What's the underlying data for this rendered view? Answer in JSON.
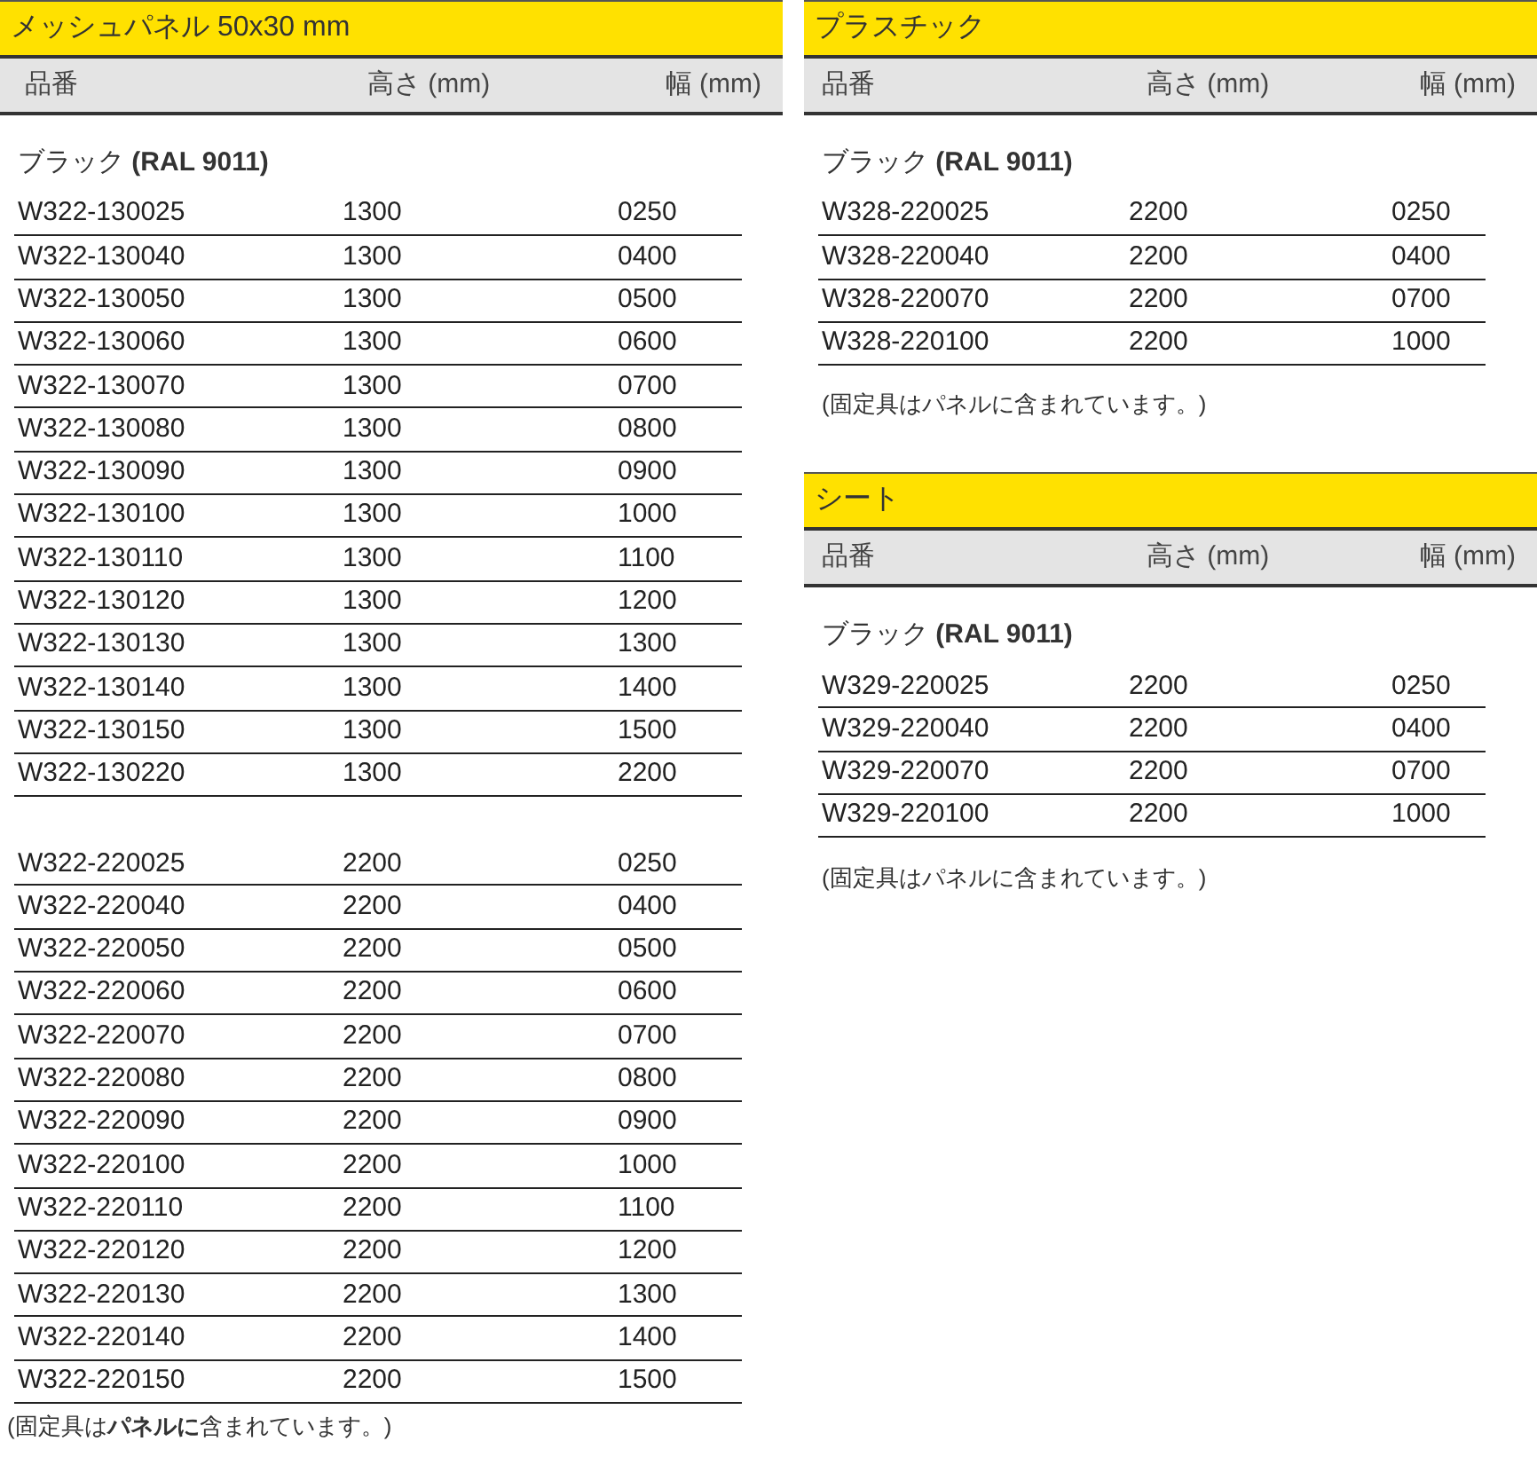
{
  "left": [
    {
      "title": "メッシュパネル 50x30 mm",
      "columns": [
        "品番",
        "高さ (mm)",
        "幅 (mm)"
      ],
      "groups": [
        {
          "label": "ブラック **(RAL 9011)**",
          "rows": [
            [
              "W322-130025",
              "1300",
              "0250"
            ],
            [
              "W322-130040",
              "1300",
              "0400"
            ],
            [
              "W322-130050",
              "1300",
              "0500"
            ],
            [
              "W322-130060",
              "1300",
              "0600"
            ],
            [
              "W322-130070",
              "1300",
              "0700"
            ],
            [
              "W322-130080",
              "1300",
              "0800"
            ],
            [
              "W322-130090",
              "1300",
              "0900"
            ],
            [
              "W322-130100",
              "1300",
              "1000"
            ],
            [
              "W322-130110",
              "1300",
              "1100"
            ],
            [
              "W322-130120",
              "1300",
              "1200"
            ],
            [
              "W322-130130",
              "1300",
              "1300"
            ],
            [
              "W322-130140",
              "1300",
              "1400"
            ],
            [
              "W322-130150",
              "1300",
              "1500"
            ],
            [
              "W322-130220",
              "1300",
              "2200"
            ]
          ]
        },
        {
          "rows": [
            [
              "W322-220025",
              "2200",
              "0250"
            ],
            [
              "W322-220040",
              "2200",
              "0400"
            ],
            [
              "W322-220050",
              "2200",
              "0500"
            ],
            [
              "W322-220060",
              "2200",
              "0600"
            ],
            [
              "W322-220070",
              "2200",
              "0700"
            ],
            [
              "W322-220080",
              "2200",
              "0800"
            ],
            [
              "W322-220090",
              "2200",
              "0900"
            ],
            [
              "W322-220100",
              "2200",
              "1000"
            ],
            [
              "W322-220110",
              "2200",
              "1100"
            ],
            [
              "W322-220120",
              "2200",
              "1200"
            ],
            [
              "W322-220130",
              "2200",
              "1300"
            ],
            [
              "W322-220140",
              "2200",
              "1400"
            ],
            [
              "W322-220150",
              "2200",
              "1500"
            ]
          ]
        }
      ],
      "note": "(固定具は**パネルに**含まれています。)"
    }
  ],
  "right": [
    {
      "title": "プラスチック",
      "columns": [
        "品番",
        "高さ (mm)",
        "幅 (mm)"
      ],
      "groups": [
        {
          "label": "ブラック **(RAL 9011)**",
          "rows": [
            [
              "W328-220025",
              "2200",
              "0250"
            ],
            [
              "W328-220040",
              "2200",
              "0400"
            ],
            [
              "W328-220070",
              "2200",
              "0700"
            ],
            [
              "W328-220100",
              "2200",
              "1000"
            ]
          ]
        }
      ],
      "note": "(固定具はパネルに含まれています。)"
    },
    {
      "title": "シート",
      "columns": [
        "品番",
        "高さ (mm)",
        "幅 (mm)"
      ],
      "groups": [
        {
          "label": "ブラック **(RAL 9011)**",
          "rows": [
            [
              "W329-220025",
              "2200",
              "0250"
            ],
            [
              "W329-220040",
              "2200",
              "0400"
            ],
            [
              "W329-220070",
              "2200",
              "0700"
            ],
            [
              "W329-220100",
              "2200",
              "1000"
            ]
          ]
        }
      ],
      "note": "(固定具はパネルに含まれています。)"
    }
  ]
}
